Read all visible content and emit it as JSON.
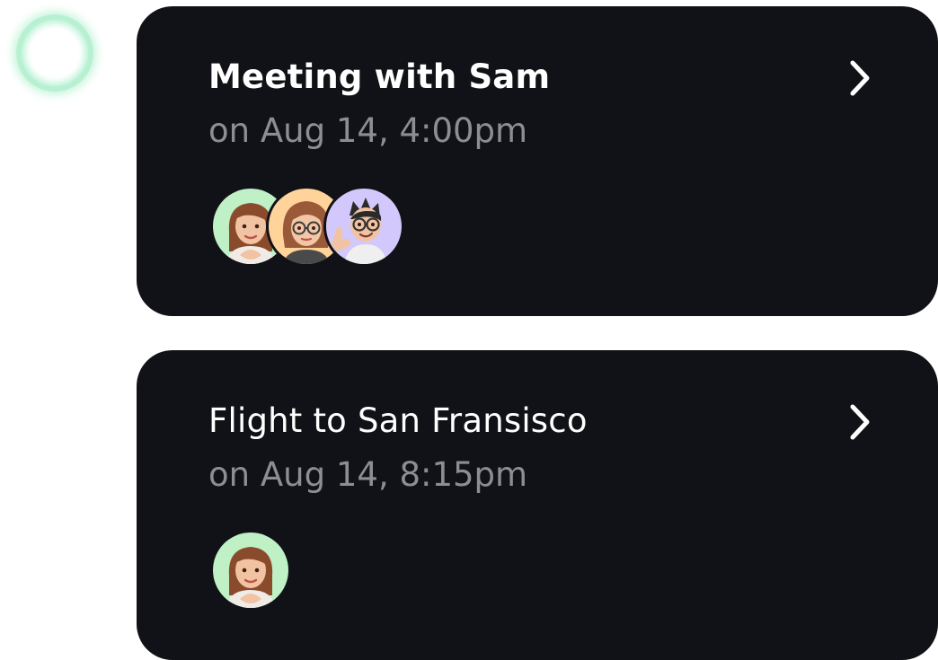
{
  "status_indicator": {
    "color": "#b8f0d2"
  },
  "events": [
    {
      "title": "Meeting with Sam",
      "time": "on Aug 14, 4:00pm",
      "chevron_icon": "chevron-right-icon",
      "participants": [
        {
          "avatar": "memoji-woman-green",
          "bg": "#bff0c6"
        },
        {
          "avatar": "memoji-woman-glasses-yellow",
          "bg": "#ffd39a"
        },
        {
          "avatar": "memoji-man-glasses-purple",
          "bg": "#d3c8fb"
        }
      ]
    },
    {
      "title": "Flight to San Fransisco",
      "time": "on Aug 14, 8:15pm",
      "chevron_icon": "chevron-right-icon",
      "participants": [
        {
          "avatar": "memoji-woman-green",
          "bg": "#bff0c6"
        }
      ]
    }
  ],
  "colors": {
    "card_bg": "#111217",
    "title": "#ffffff",
    "subtitle": "#8d8e94"
  }
}
